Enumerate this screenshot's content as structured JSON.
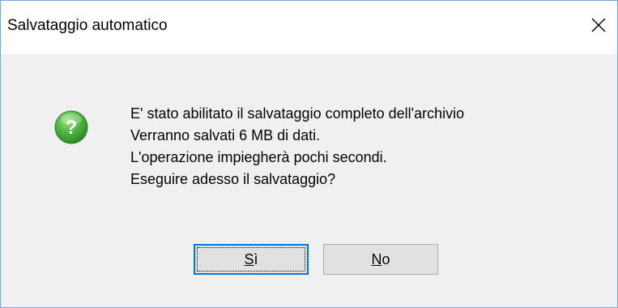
{
  "dialog": {
    "title": "Salvataggio automatico",
    "close_icon": "close-icon",
    "icon": "question-icon",
    "icon_color": "#3aa83a",
    "message_lines": [
      "E' stato abilitato il salvataggio completo dell'archivio",
      "Verranno salvati 6 MB di dati.",
      "L'operazione impiegherà pochi secondi.",
      "Eseguire adesso il salvataggio?"
    ],
    "buttons": {
      "yes": {
        "mnemonic": "S",
        "rest": "ì"
      },
      "no": {
        "mnemonic": "N",
        "rest": "o"
      }
    },
    "accent_color": "#0078d7"
  }
}
